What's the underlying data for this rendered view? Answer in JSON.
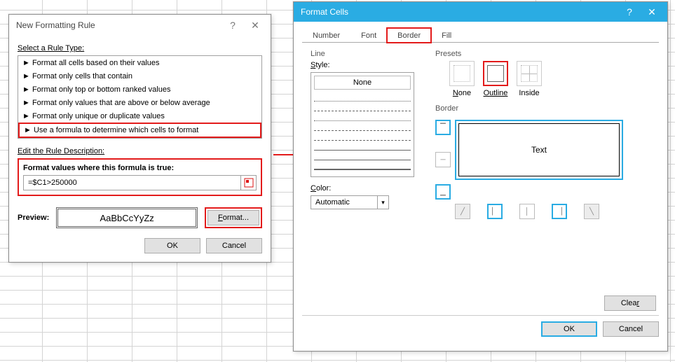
{
  "formatting_rule": {
    "title": "New Formatting Rule",
    "select_label": "Select a Rule Type:",
    "rules": [
      "Format all cells based on their values",
      "Format only cells that contain",
      "Format only top or bottom ranked values",
      "Format only values that are above or below average",
      "Format only unique or duplicate values",
      "Use a formula to determine which cells to format"
    ],
    "edit_label": "Edit the Rule Description:",
    "formula_label": "Format values where this formula is true:",
    "formula_value": "=$C1>250000",
    "preview_label": "Preview:",
    "preview_sample": "AaBbCcYyZz",
    "format_btn": "Format...",
    "ok": "OK",
    "cancel": "Cancel"
  },
  "format_cells": {
    "title": "Format Cells",
    "tabs": {
      "number": "Number",
      "font": "Font",
      "border": "Border",
      "fill": "Fill"
    },
    "line_label": "Line",
    "style_label": "Style:",
    "none_label": "None",
    "color_label": "Color:",
    "color_value": "Automatic",
    "presets_label": "Presets",
    "preset_none": "None",
    "preset_outline": "Outline",
    "preset_inside": "Inside",
    "border_label": "Border",
    "text_label": "Text",
    "clear": "Clear",
    "ok": "OK",
    "cancel": "Cancel"
  }
}
